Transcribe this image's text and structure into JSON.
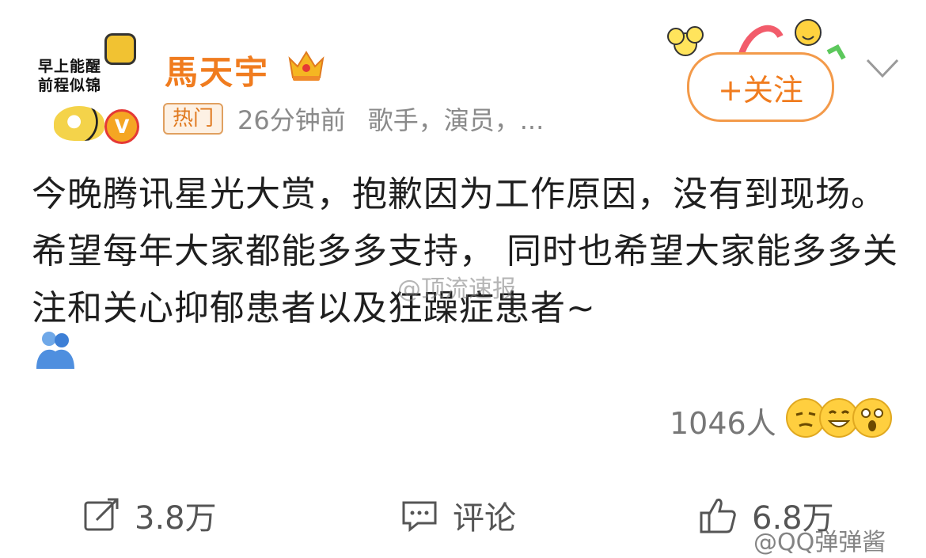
{
  "avatar": {
    "text_line1": "早上能醒",
    "text_line2": "前程似锦",
    "vip_letter": "V"
  },
  "post": {
    "username": "馬天宇",
    "hot_tag": "热门",
    "time": "26分钟前",
    "user_description": "歌手，演员，...",
    "follow_label": "+关注",
    "text": "今晚腾讯星光大赏，抱歉因为工作原因，没有到现场。希望每年大家都能多多支持， 同时也希望大家能多多关注和关心抑郁患者以及狂躁症患者~",
    "reaction_count": "1046人"
  },
  "actions": {
    "repost_count": "3.8万",
    "comment_label": "评论",
    "like_count": "6.8万"
  },
  "watermarks": {
    "middle": "@顶流速报",
    "bottom": "@QQ弹弹酱"
  },
  "colors": {
    "accent": "#f07c1f",
    "text": "#1f1f1f",
    "muted": "#8a8a8a"
  }
}
